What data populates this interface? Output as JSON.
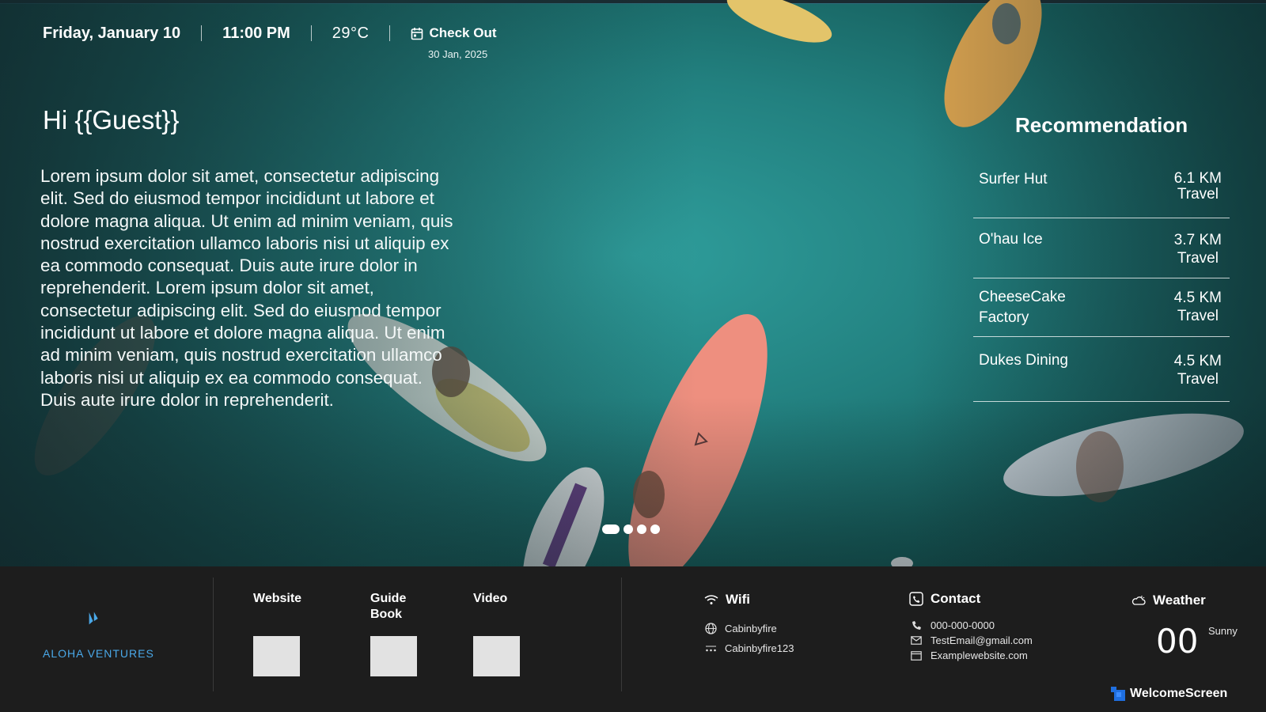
{
  "header": {
    "date": "Friday, January 10",
    "time": "11:00 PM",
    "temperature": "29°C",
    "checkout_label": "Check Out",
    "checkout_date": "30 Jan, 2025"
  },
  "greeting": "Hi {{Guest}}",
  "body_text": "Lorem ipsum dolor sit amet, consectetur adipiscing elit. Sed do eiusmod tempor incididunt ut labore et dolore magna aliqua. Ut enim ad minim veniam, quis nostrud exercitation ullamco laboris nisi ut aliquip ex ea commodo consequat. Duis aute irure dolor in reprehenderit. Lorem ipsum dolor sit amet, consectetur adipiscing elit. Sed do eiusmod tempor incididunt ut labore et dolore magna aliqua. Ut enim ad minim veniam, quis nostrud exercitation ullamco laboris nisi ut aliquip ex ea commodo consequat. Duis aute irure dolor in reprehenderit.",
  "recommendation": {
    "title": "Recommendation",
    "items": [
      {
        "name": "Surfer Hut",
        "distance": "6.1 KM",
        "mode": "Travel"
      },
      {
        "name": "O'hau Ice",
        "distance": "3.7 KM",
        "mode": "Travel"
      },
      {
        "name": "CheeseCake Factory",
        "distance": "4.5 KM",
        "mode": "Travel"
      },
      {
        "name": "Dukes Dining",
        "distance": "4.5 KM",
        "mode": "Travel"
      }
    ]
  },
  "carousel": {
    "slide_count": 4,
    "active_index": 0
  },
  "footer": {
    "logo_text": "ALOHA VENTURES",
    "links": [
      {
        "label": "Website"
      },
      {
        "label": "Guide\nBook"
      },
      {
        "label": "Video"
      }
    ],
    "wifi": {
      "title": "Wifi",
      "network": "Cabinbyfire",
      "password": "Cabinbyfire123"
    },
    "contact": {
      "title": "Contact",
      "phone": "000-000-0000",
      "email": "TestEmail@gmail.com",
      "website": "Examplewebsite.com"
    },
    "weather": {
      "title": "Weather",
      "value": "00",
      "condition": "Sunny"
    },
    "brand": "WelcomeScreen"
  },
  "colors": {
    "accent_logo": "#4aa8e8",
    "brand_icon": "#1f6fe0",
    "footer_bg": "#1d1d1d",
    "sea": "#22807f"
  }
}
